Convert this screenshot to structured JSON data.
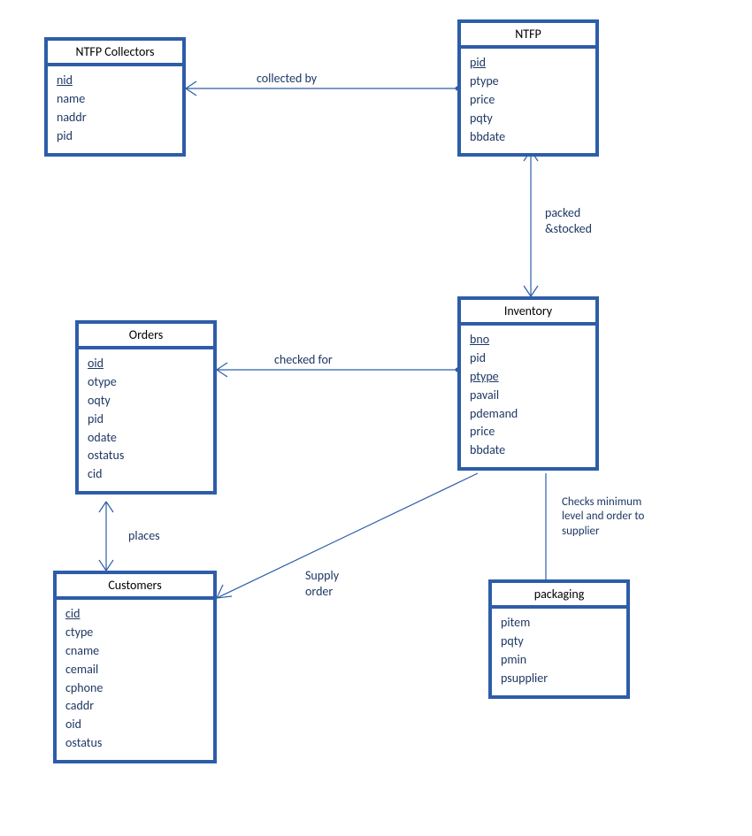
{
  "entities": {
    "ntfp_collectors": {
      "title": "NTFP Collectors",
      "attrs": [
        {
          "name": "nid",
          "pk": true
        },
        {
          "name": "name",
          "pk": false
        },
        {
          "name": "naddr",
          "pk": false
        },
        {
          "name": "pid",
          "pk": false
        }
      ]
    },
    "ntfp": {
      "title": "NTFP",
      "attrs": [
        {
          "name": "pid",
          "pk": true
        },
        {
          "name": "ptype",
          "pk": false
        },
        {
          "name": "price",
          "pk": false
        },
        {
          "name": "pqty",
          "pk": false
        },
        {
          "name": "bbdate",
          "pk": false
        }
      ]
    },
    "orders": {
      "title": "Orders",
      "attrs": [
        {
          "name": "oid",
          "pk": true
        },
        {
          "name": "otype",
          "pk": false
        },
        {
          "name": "oqty",
          "pk": false
        },
        {
          "name": "pid",
          "pk": false
        },
        {
          "name": "odate",
          "pk": false
        },
        {
          "name": "ostatus",
          "pk": false
        },
        {
          "name": "cid",
          "pk": false
        }
      ]
    },
    "inventory": {
      "title": "Inventory",
      "attrs": [
        {
          "name": "bno",
          "pk": true
        },
        {
          "name": "pid",
          "pk": false
        },
        {
          "name": "ptype",
          "pk": true
        },
        {
          "name": "pavail",
          "pk": false
        },
        {
          "name": "pdemand",
          "pk": false
        },
        {
          "name": "price",
          "pk": false
        },
        {
          "name": "bbdate",
          "pk": false
        }
      ]
    },
    "customers": {
      "title": "Customers",
      "attrs": [
        {
          "name": "cid",
          "pk": true
        },
        {
          "name": "ctype",
          "pk": false
        },
        {
          "name": "cname",
          "pk": false
        },
        {
          "name": "cemail",
          "pk": false
        },
        {
          "name": "cphone",
          "pk": false
        },
        {
          "name": "caddr",
          "pk": false
        },
        {
          "name": "oid",
          "pk": false
        },
        {
          "name": "ostatus",
          "pk": false
        }
      ]
    },
    "packaging": {
      "title": "packaging",
      "attrs": [
        {
          "name": "pitem",
          "pk": false
        },
        {
          "name": "pqty",
          "pk": false
        },
        {
          "name": "pmin",
          "pk": false
        },
        {
          "name": "psupplier",
          "pk": false
        }
      ]
    }
  },
  "relationships": {
    "collected_by": "collected by",
    "packed_stocked": "packed\n&stocked",
    "checked_for": "checked for",
    "places": "places",
    "supply_order": "Supply\norder",
    "checks_minimum": "Checks minimum \nlevel and order to \nsupplier"
  }
}
